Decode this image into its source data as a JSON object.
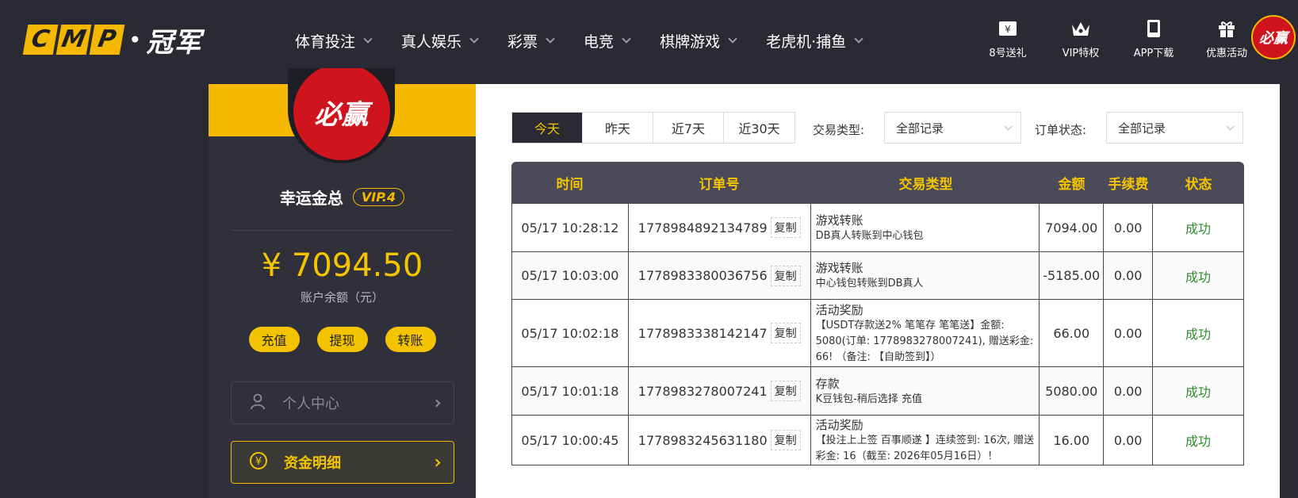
{
  "brand": {
    "letters": [
      "C",
      "M",
      "P"
    ],
    "name": "冠军"
  },
  "nav": [
    {
      "label": "体育投注"
    },
    {
      "label": "真人娱乐"
    },
    {
      "label": "彩票"
    },
    {
      "label": "电竞"
    },
    {
      "label": "棋牌游戏"
    },
    {
      "label": "老虎机·捕鱼"
    }
  ],
  "right_nav": [
    {
      "label": "8号送礼",
      "icon": "ticket-icon"
    },
    {
      "label": "VIP特权",
      "icon": "crown-icon"
    },
    {
      "label": "APP下载",
      "icon": "phone-icon"
    },
    {
      "label": "优惠活动",
      "icon": "gift-icon"
    }
  ],
  "avatar_text": "必赢",
  "sidebar": {
    "username": "幸运金总",
    "vip": "VIP.4",
    "balance": "¥ 7094.50",
    "balance_label": "账户余额（元）",
    "actions": [
      "充值",
      "提现",
      "转账"
    ],
    "menu": [
      {
        "label": "个人中心",
        "icon": "user-icon"
      },
      {
        "label": "资金明细",
        "icon": "yen-coin-icon"
      }
    ]
  },
  "filters": {
    "tabs": [
      "今天",
      "昨天",
      "近7天",
      "近30天"
    ],
    "active_tab": "今天",
    "type_label": "交易类型:",
    "type_value": "全部记录",
    "status_label": "订单状态:",
    "status_value": "全部记录"
  },
  "table": {
    "headers": [
      "时间",
      "订单号",
      "交易类型",
      "金额",
      "手续费",
      "状态"
    ],
    "copy_label": "复制",
    "rows": [
      {
        "time": "05/17 10:28:12",
        "order": "1778984892134789",
        "type": "游戏转账",
        "desc": "DB真人转账到中心钱包",
        "amount": "7094.00",
        "fee": "0.00",
        "status": "成功"
      },
      {
        "time": "05/17 10:03:00",
        "order": "1778983380036756",
        "type": "游戏转账",
        "desc": "中心钱包转账到DB真人",
        "amount": "-5185.00",
        "fee": "0.00",
        "status": "成功"
      },
      {
        "time": "05/17 10:02:18",
        "order": "1778983338142147",
        "type": "活动奖励",
        "desc": "【USDT存款送2% 笔笔存 笔笔送】金额: 5080(订单: 1778983278007241), 赠送彩金: 66! （备注: 【自助签到】）",
        "amount": "66.00",
        "fee": "0.00",
        "status": "成功"
      },
      {
        "time": "05/17 10:01:18",
        "order": "1778983278007241",
        "type": "存款",
        "desc": "K豆钱包-稍后选择 充值",
        "amount": "5080.00",
        "fee": "0.00",
        "status": "成功"
      },
      {
        "time": "05/17 10:00:45",
        "order": "1778983245631180",
        "type": "活动奖励",
        "desc": "【投注上上签 百事顺遂 】连续签到: 16次, 赠送彩金: 16（截至: 2026年05月16日）！",
        "amount": "16.00",
        "fee": "0.00",
        "status": "成功"
      }
    ]
  },
  "colors": {
    "accent": "#f5c400",
    "dark": "#2a2a34",
    "success": "#2e8b2e",
    "brand_red": "#d0141e"
  }
}
